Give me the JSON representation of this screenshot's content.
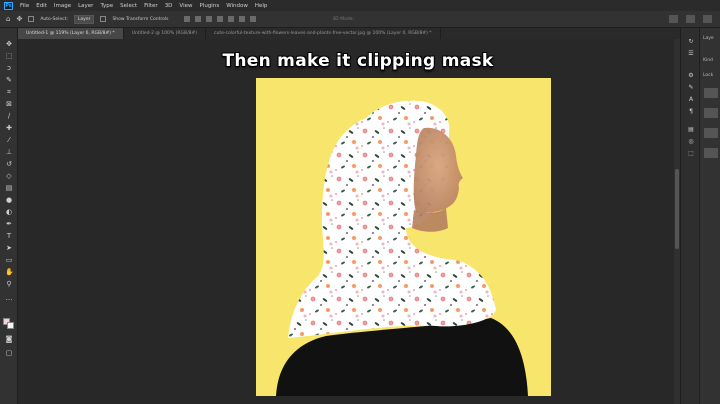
{
  "menubar": {
    "logo": "Ps",
    "items": [
      "File",
      "Edit",
      "Image",
      "Layer",
      "Type",
      "Select",
      "Filter",
      "3D",
      "View",
      "Plugins",
      "Window",
      "Help"
    ]
  },
  "options": {
    "auto_select_label": "Auto-Select:",
    "auto_select_value": "Layer",
    "transform_label": "Show Transform Controls",
    "mode_label": "3D Mode:"
  },
  "tabs": [
    "Untitled-1 @ 119% (Layer 6, RGB/8#) *",
    "Untitled-2 @ 100% (RGB/8#)",
    "cute-colorful-texture-with-flowers-leaves-and-plants-free-vector.jpg @ 100% (Layer 0, RGB/8#) *"
  ],
  "canvas": {
    "headline": "Then make it clipping mask",
    "background_color": "#f8e56c",
    "hijab_color": "#ffffff",
    "garment_color": "#111111"
  },
  "right_panel": {
    "labels": [
      "Laye",
      "Kind",
      "Lock"
    ]
  },
  "icons": {
    "tools": [
      "move-icon",
      "marquee-icon",
      "lasso-icon",
      "quick-select-icon",
      "crop-icon",
      "frame-icon",
      "eyedropper-icon",
      "healing-icon",
      "brush-icon",
      "stamp-icon",
      "history-brush-icon",
      "eraser-icon",
      "gradient-icon",
      "blur-icon",
      "dodge-icon",
      "pen-icon",
      "type-icon",
      "path-select-icon",
      "shape-icon",
      "hand-icon",
      "zoom-icon"
    ]
  }
}
